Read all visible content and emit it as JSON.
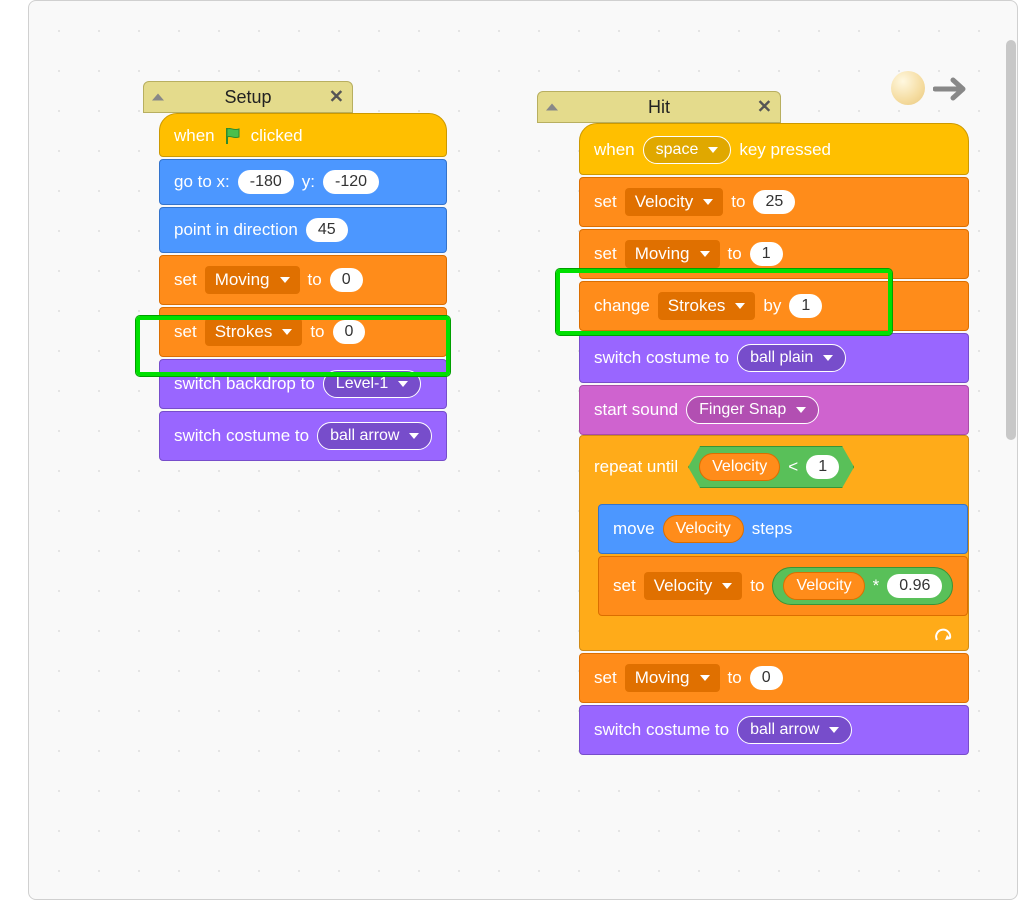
{
  "colors": {
    "events": "#ffbf00",
    "motion": "#4c97ff",
    "data": "#ff8c1a",
    "looks": "#9966ff",
    "sound": "#cf63cf",
    "control": "#ffab19",
    "operators": "#59c059"
  },
  "setup": {
    "comment_title": "Setup",
    "hat_when": "when",
    "hat_clicked": "clicked",
    "goto_prefix": "go to x:",
    "goto_x": "-180",
    "goto_ymid": "y:",
    "goto_y": "-120",
    "point_label": "point in direction",
    "point_val": "45",
    "set1_set": "set",
    "set1_var": "Moving",
    "set1_to": "to",
    "set1_val": "0",
    "set2_set": "set",
    "set2_var": "Strokes",
    "set2_to": "to",
    "set2_val": "0",
    "backdrop_label": "switch backdrop to",
    "backdrop_val": "Level-1",
    "costume_label": "switch costume to",
    "costume_val": "ball arrow"
  },
  "hit": {
    "comment_title": "Hit",
    "hat_when": "when",
    "hat_key": "space",
    "hat_pressed": "key pressed",
    "set1_set": "set",
    "set1_var": "Velocity",
    "set1_to": "to",
    "set1_val": "25",
    "set2_set": "set",
    "set2_var": "Moving",
    "set2_to": "to",
    "set2_val": "1",
    "change_label": "change",
    "change_var": "Strokes",
    "change_by": "by",
    "change_val": "1",
    "costume1_label": "switch costume to",
    "costume1_val": "ball plain",
    "sound_label": "start sound",
    "sound_val": "Finger Snap",
    "repeat_label": "repeat until",
    "repeat_cond_var": "Velocity",
    "repeat_cond_op": "<",
    "repeat_cond_val": "1",
    "move_label": "move",
    "move_var": "Velocity",
    "move_steps": "steps",
    "setv_set": "set",
    "setv_var": "Velocity",
    "setv_to": "to",
    "setv_expr_var": "Velocity",
    "setv_expr_op": "*",
    "setv_expr_val": "0.96",
    "set3_set": "set",
    "set3_var": "Moving",
    "set3_to": "to",
    "set3_val": "0",
    "costume2_label": "switch costume to",
    "costume2_val": "ball arrow"
  }
}
